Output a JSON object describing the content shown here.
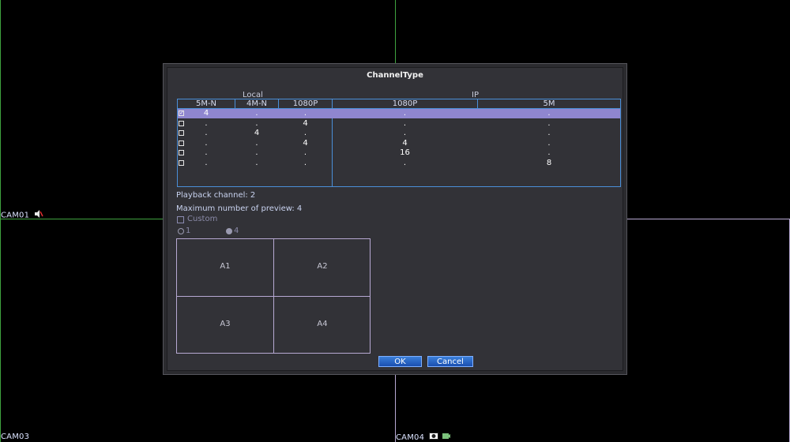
{
  "cameras": [
    {
      "label": "CAM01"
    },
    {
      "label": "CAM03"
    },
    {
      "label": "CAM04"
    }
  ],
  "dialog": {
    "title": "ChannelType",
    "groups": {
      "local": "Local",
      "ip": "IP"
    },
    "columns": [
      "5M-N",
      "4M-N",
      "1080P",
      "1080P",
      "5M"
    ],
    "rows": [
      {
        "checked": true,
        "selected": true,
        "cells": [
          "4",
          ".",
          ".",
          ".",
          "."
        ]
      },
      {
        "checked": false,
        "selected": false,
        "cells": [
          ".",
          ".",
          "4",
          ".",
          "."
        ]
      },
      {
        "checked": false,
        "selected": false,
        "cells": [
          ".",
          "4",
          ".",
          ".",
          "."
        ]
      },
      {
        "checked": false,
        "selected": false,
        "cells": [
          ".",
          ".",
          "4",
          "4",
          "."
        ]
      },
      {
        "checked": false,
        "selected": false,
        "cells": [
          ".",
          ".",
          ".",
          "16",
          "."
        ]
      },
      {
        "checked": false,
        "selected": false,
        "cells": [
          ".",
          ".",
          ".",
          ".",
          "8"
        ]
      }
    ],
    "playback": "Playback channel: 2",
    "max_preview": "Maximum number of preview: 4",
    "custom_label": "Custom",
    "radio_options": [
      "1",
      "4"
    ],
    "preview_cells": [
      "A1",
      "A2",
      "A3",
      "A4"
    ],
    "ok_label": "OK",
    "cancel_label": "Cancel"
  },
  "colors": {
    "grid_green": "#3fa33f",
    "grid_purple": "#b7a9d3",
    "accent_blue": "#4a8fd8",
    "selection": "#8f86cf",
    "button": "#1f5fc2"
  }
}
